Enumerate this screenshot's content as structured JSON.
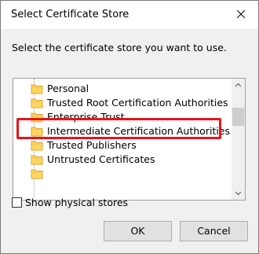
{
  "window": {
    "title": "Select Certificate Store"
  },
  "dialog": {
    "prompt": "Select the certificate store you want to use.",
    "stores": [
      {
        "label": "Personal"
      },
      {
        "label": "Trusted Root Certification Authorities"
      },
      {
        "label": "Enterprise Trust"
      },
      {
        "label": "Intermediate Certification Authorities",
        "highlighted": true
      },
      {
        "label": "Trusted Publishers"
      },
      {
        "label": "Untrusted Certificates"
      },
      {
        "label": ""
      }
    ],
    "show_physical_stores": {
      "label": "Show physical stores",
      "checked": false
    },
    "ok_label": "OK",
    "cancel_label": "Cancel"
  },
  "colors": {
    "highlight_border": "#e8141c",
    "folder_fill": "#ffd75e",
    "folder_edge": "#dca63a",
    "dialog_bg": "#f0f0f0"
  },
  "icons": {
    "close": "close-icon",
    "folder": "folder-icon",
    "scroll_up": "chevron-up-icon",
    "scroll_down": "chevron-down-icon"
  }
}
